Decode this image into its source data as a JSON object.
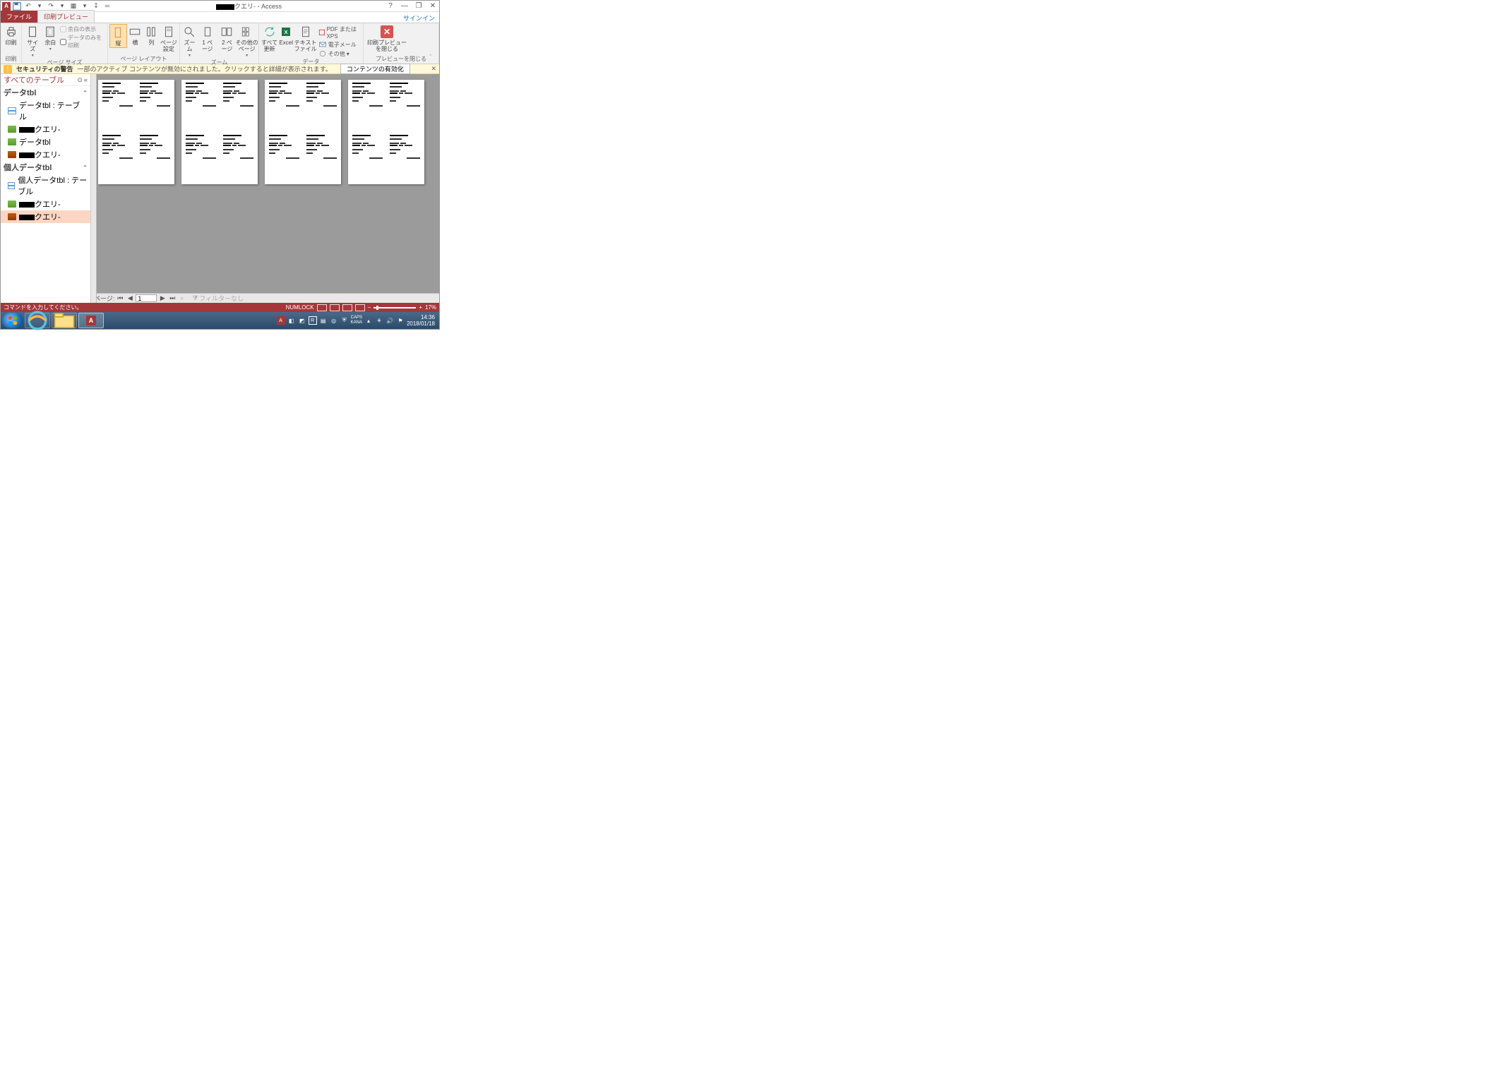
{
  "titlebar": {
    "app_prefix": "クエリ- - ",
    "app_name": "Access"
  },
  "tabs": {
    "file": "ファイル",
    "print_preview": "印刷プレビュー",
    "signin": "サインイン"
  },
  "ribbon": {
    "print": {
      "label": "印刷",
      "group": "印刷"
    },
    "pagesize": {
      "size": "サイズ",
      "margins": "余白",
      "show_margins": "余白の表示",
      "data_only": "データのみを印刷",
      "group": "ページ サイズ"
    },
    "pagelayout": {
      "portrait": "縦",
      "landscape": "横",
      "columns": "列",
      "page_setup": "ページ\n設定",
      "group": "ページ レイアウト"
    },
    "zoom": {
      "zoom": "ズーム",
      "one_page": "1 ページ",
      "two_pages": "2 ページ",
      "other_pages": "その他の\nページ",
      "group": "ズーム"
    },
    "data": {
      "refresh_all": "すべて\n更新",
      "excel": "Excel",
      "text_file": "テキスト\nファイル",
      "pdf_xps": "PDF または XPS",
      "email": "電子メール",
      "other": "その他",
      "group": "データ"
    },
    "close": {
      "label": "印刷プレビュー\nを閉じる",
      "group": "プレビューを閉じる"
    }
  },
  "security": {
    "title": "セキュリティの警告",
    "msg": "一部のアクティブ コンテンツが無効にされました。クリックすると詳細が表示されます。",
    "enable": "コンテンツの有効化"
  },
  "nav": {
    "title": "すべてのテーブル",
    "groups": [
      {
        "name": "データtbl",
        "items": [
          {
            "type": "table",
            "label": "データtbl : テーブル"
          },
          {
            "type": "query",
            "label": "クエリ-",
            "redact": true
          },
          {
            "type": "query",
            "label": "データtbl"
          },
          {
            "type": "report",
            "label": "クエリ-",
            "redact": true
          }
        ]
      },
      {
        "name": "個人データtbl",
        "items": [
          {
            "type": "table",
            "label": "個人データtbl : テーブル"
          },
          {
            "type": "query",
            "label": "クエリ-",
            "redact": true
          },
          {
            "type": "report",
            "label": "クエリ-",
            "redact": true,
            "selected": true
          }
        ]
      }
    ]
  },
  "pagenav": {
    "label": "ページ:",
    "current": "1",
    "filter_none": "フィルターなし"
  },
  "statusbar": {
    "prompt": "コマンドを入力してください。",
    "numlock": "NUMLOCK",
    "zoom": "17%"
  },
  "taskbar": {
    "caps": "CAPS",
    "kana": "KANA",
    "time": "14:36",
    "date": "2018/01/18"
  }
}
